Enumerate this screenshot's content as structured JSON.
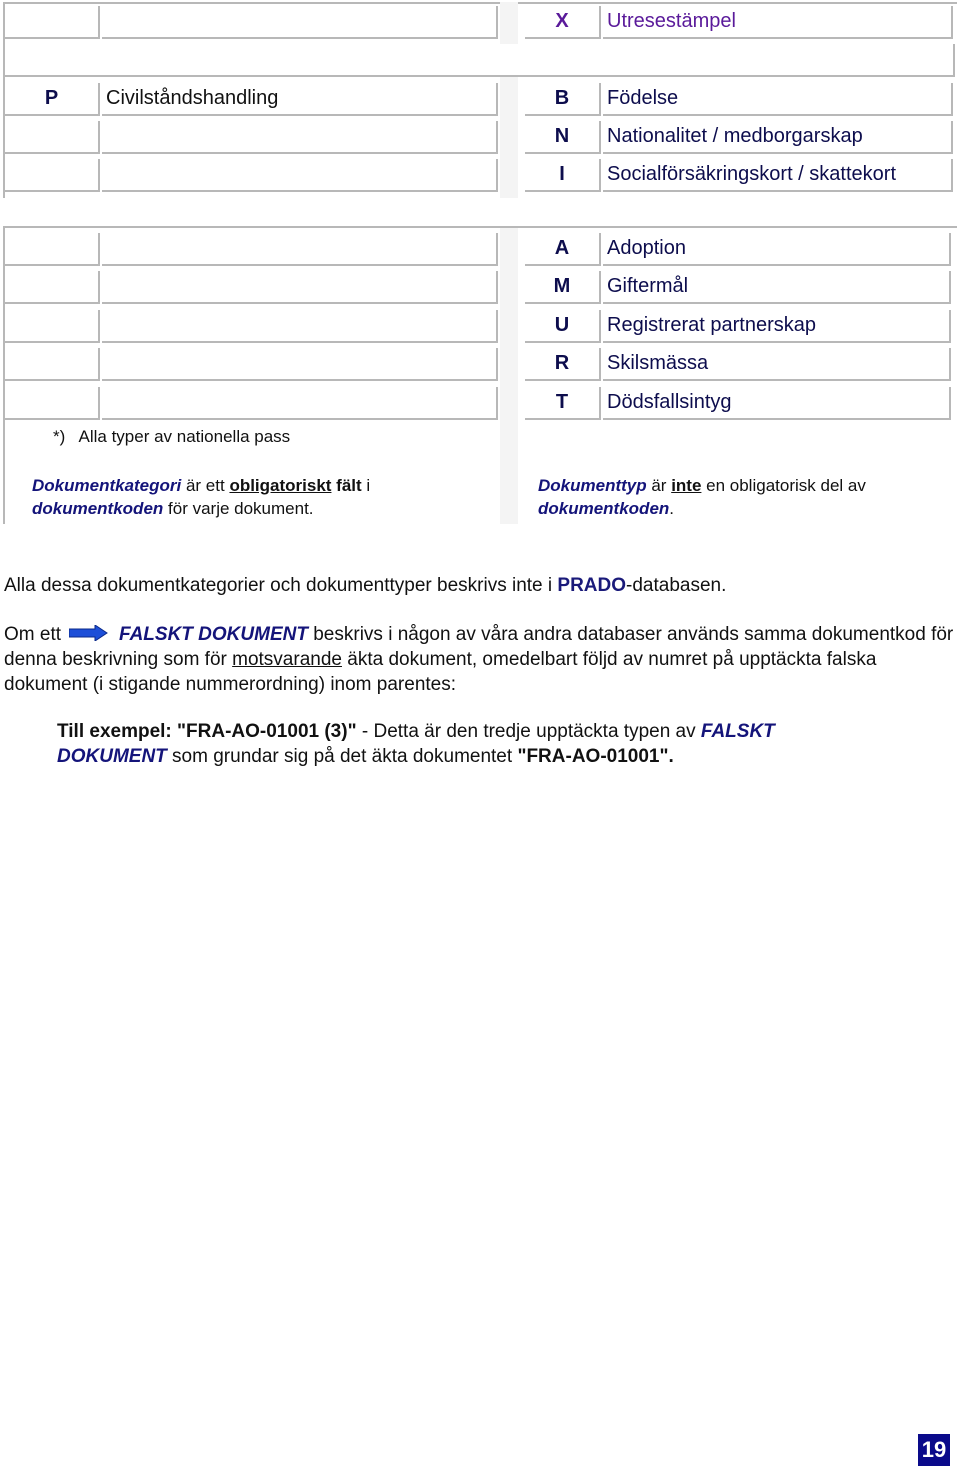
{
  "table1": {
    "left_rows": [
      {
        "code": "",
        "label": ""
      },
      {
        "code": "",
        "label": ""
      },
      {
        "code": "P",
        "label": "Civilståndshandling"
      },
      {
        "code": "",
        "label": ""
      },
      {
        "code": "",
        "label": ""
      }
    ],
    "right_rows": [
      {
        "code": "X",
        "label": "Utresestämpel"
      },
      {
        "code": "B",
        "label": "Födelse"
      },
      {
        "code": "N",
        "label": "Nationalitet / medborgarskap"
      },
      {
        "code": "I",
        "label": "Socialförsäkringskort / skattekort"
      }
    ]
  },
  "table2": {
    "right_rows": [
      {
        "code": "A",
        "label": "Adoption"
      },
      {
        "code": "M",
        "label": "Giftermål"
      },
      {
        "code": "U",
        "label": "Registrerat partnerskap"
      },
      {
        "code": "R",
        "label": "Skilsmässa"
      },
      {
        "code": "T",
        "label": "Dödsfallsintyg"
      }
    ],
    "footnote": "*)   Alla typer av nationella pass",
    "left_note": {
      "term": "Dokumentkategori",
      "t1": " är ett ",
      "underlined": "obligatoriskt",
      "bold": " fält",
      "t2": " i ",
      "term2": "dokumentkoden",
      "t3": " för varje dokument."
    },
    "right_note": {
      "term": "Dokumenttyp",
      "t1": " är ",
      "underlined": "inte",
      "t2": " en obligatorisk del av ",
      "term2": "dokumentkoden",
      "t3": "."
    }
  },
  "paragraph1": {
    "before": "Alla dessa dokumentkategorier och dokumenttyper beskrivs inte i ",
    "highlight": "PRADO",
    "after": "-databasen."
  },
  "paragraph2": {
    "before": "Om ett",
    "icon": "arrow-right-icon",
    "falskt": "FALSKT DOKUMENT",
    "t1": " beskrivs i någon av våra andra databaser används samma dokumentkod för denna beskrivning som för ",
    "underlined": "motsvarande",
    "t2": " äkta dokument, omedelbart följd av numret på upptäckta falska dokument (i stigande nummerordning) inom parentes:"
  },
  "example": {
    "bold1": "Till exempel: \"FRA-AO-01001 (3)\"",
    "t1": " - Detta är den tredje upptäckta typen av ",
    "falskt": "FALSKT DOKUMENT",
    "t2": " som grundar sig på det äkta dokumentet ",
    "bold2": "\"FRA-AO-01001\"."
  },
  "page_number": "19",
  "colors": {
    "accent_navy": "#14147a",
    "purple_entry": "#5a1a9a",
    "page_badge": "#0a0a8a",
    "border_gray": "#b8b8b8"
  }
}
